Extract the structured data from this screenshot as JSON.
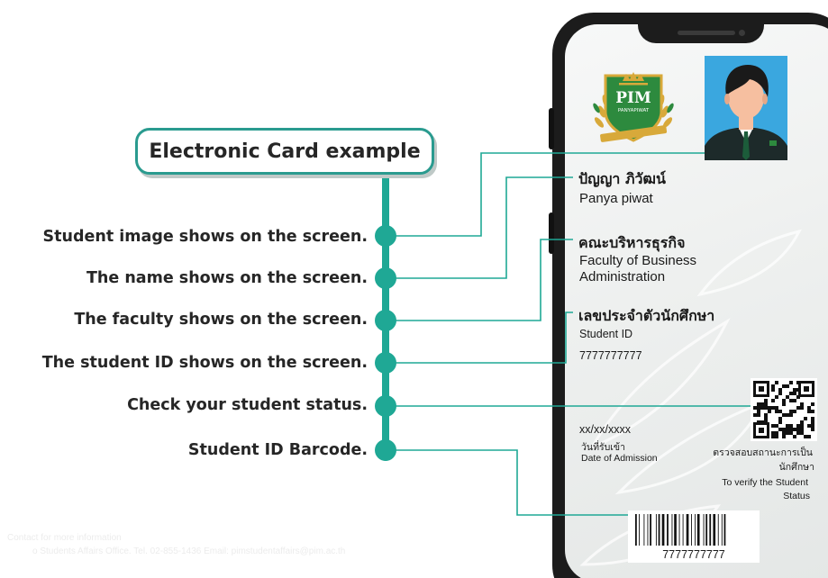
{
  "title": "Electronic Card example",
  "labels": [
    "Student image shows on the screen.",
    "The name shows on the screen.",
    "The faculty shows on the screen.",
    "The student ID shows on the screen.",
    "Check your student status.",
    "Student ID Barcode."
  ],
  "card": {
    "logo_text": "PIM",
    "logo_subtext": "PANYAPIWAT",
    "name_th": "ปัญญา ภิวัฒน์",
    "name_en": "Panya piwat",
    "faculty_th": "คณะบริหารธุรกิจ",
    "faculty_en_1": "Faculty of Business",
    "faculty_en_2": "Administration",
    "id_label_th": "เลขประจำตัวนักศึกษา",
    "id_label_en": "Student ID",
    "id_value": "7777777777",
    "admission_date": "xx/xx/xxxx",
    "admission_th": "วันที่รับเข้า",
    "admission_en": "Date of Admission",
    "verify_th_1": "ตรวจสอบสถานะการเป็น",
    "verify_th_2": "นักศึกษา",
    "verify_en_1": "To verify the Student",
    "verify_en_2": "Status",
    "barcode_value": "7777777777"
  },
  "footer": {
    "line1": "Contact for more information",
    "line2": "o Students Affairs Office. Tel. 02-855-1436 Email: pimstudentaffairs@pim.ac.th"
  },
  "colors": {
    "accent": "#1fa895",
    "photo_bg": "#3aa7df",
    "logo_green": "#2d8a3e",
    "logo_gold": "#d8a93a"
  }
}
